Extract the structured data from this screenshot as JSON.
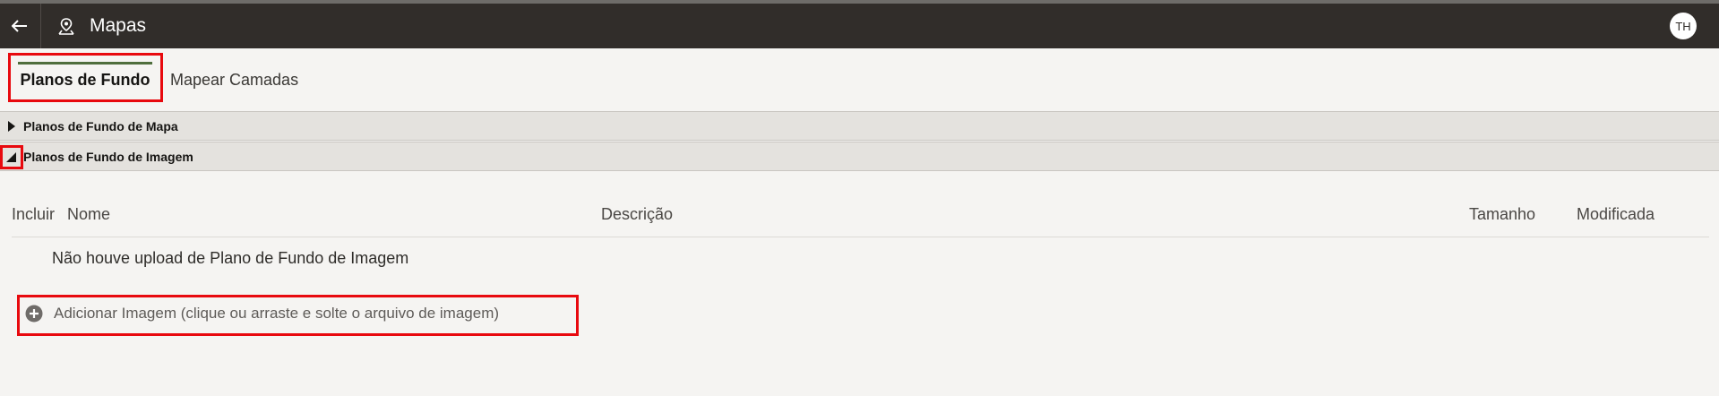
{
  "header": {
    "title": "Mapas",
    "avatar_initials": "TH",
    "back_icon": "back-arrow-icon",
    "app_icon": "map-pin-icon"
  },
  "tabs": [
    {
      "label": "Planos de Fundo",
      "active": true
    },
    {
      "label": "Mapear Camadas",
      "active": false
    }
  ],
  "sections": [
    {
      "label": "Planos de Fundo de Mapa",
      "expanded": false
    },
    {
      "label": "Planos de Fundo de Imagem",
      "expanded": true
    }
  ],
  "table": {
    "columns": [
      "Incluir",
      "Nome",
      "Descrição",
      "Tamanho",
      "Modificada"
    ],
    "empty_message": "Não houve upload de Plano de Fundo de Imagem"
  },
  "add_image": {
    "label": "Adicionar Imagem (clique ou arraste e solte o arquivo de imagem)",
    "icon": "plus-circle-icon"
  },
  "colors": {
    "header_bg": "#312d2a",
    "active_tab_underline": "#4f6e3d",
    "highlight": "#e8090e"
  }
}
